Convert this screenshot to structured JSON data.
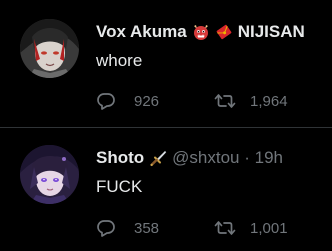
{
  "colors": {
    "background": "#000000",
    "text": "#e7e9ea",
    "secondary": "#71767b",
    "divider": "#2f3336"
  },
  "tweets": [
    {
      "display_name": "Vox Akuma",
      "badges": [
        "ogre-emoji",
        "red-envelope-emoji"
      ],
      "affiliation": "NIJISAN",
      "handle": "",
      "time": "",
      "text": "whore",
      "replies": "926",
      "retweets": "1,964"
    },
    {
      "display_name": "Shoto",
      "badges": [
        "dagger-emoji"
      ],
      "handle": "@shxtou · 19h",
      "text": "FUCK",
      "replies": "358",
      "retweets": "1,001"
    }
  ]
}
